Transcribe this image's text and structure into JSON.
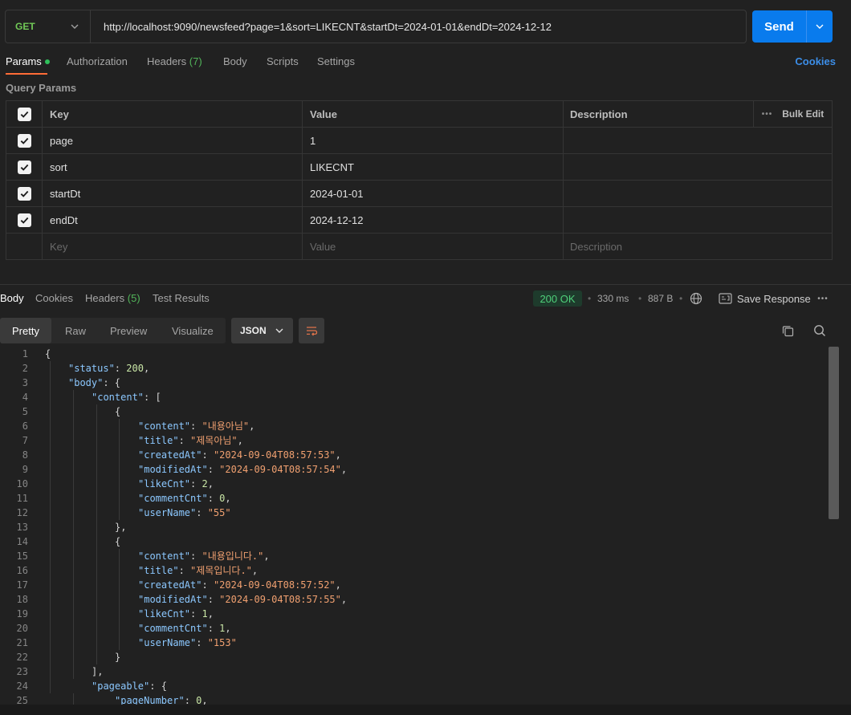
{
  "request": {
    "method": "GET",
    "url": "http://localhost:9090/newsfeed?page=1&sort=LIKECNT&startDt=2024-01-01&endDt=2024-12-12",
    "send_label": "Send"
  },
  "request_tabs": [
    {
      "label": "Params",
      "active": true
    },
    {
      "label": "Authorization"
    },
    {
      "label": "Headers",
      "count": "(7)"
    },
    {
      "label": "Body"
    },
    {
      "label": "Scripts"
    },
    {
      "label": "Settings"
    }
  ],
  "cookies_label": "Cookies",
  "query_params": {
    "title": "Query Params",
    "headers": {
      "key": "Key",
      "value": "Value",
      "description": "Description",
      "bulk_edit": "Bulk Edit"
    },
    "rows": [
      {
        "key": "page",
        "value": "1",
        "checked": true
      },
      {
        "key": "sort",
        "value": "LIKECNT",
        "checked": true
      },
      {
        "key": "startDt",
        "value": "2024-01-01",
        "checked": true
      },
      {
        "key": "endDt",
        "value": "2024-12-12",
        "checked": true
      }
    ],
    "placeholders": {
      "key": "Key",
      "value": "Value",
      "description": "Description"
    }
  },
  "response_tabs": [
    {
      "label": "Body",
      "active": true
    },
    {
      "label": "Cookies"
    },
    {
      "label": "Headers",
      "count": "(5)"
    },
    {
      "label": "Test Results"
    }
  ],
  "response_meta": {
    "status": "200 OK",
    "time": "330 ms",
    "size": "887 B",
    "save_label": "Save Response"
  },
  "view_tabs": [
    {
      "label": "Pretty",
      "active": true
    },
    {
      "label": "Raw"
    },
    {
      "label": "Preview"
    },
    {
      "label": "Visualize"
    }
  ],
  "format": "JSON",
  "colors": {
    "accent": "#ff6c37",
    "send": "#097bed",
    "method_get": "#71c957",
    "status_ok": "#4fd07a",
    "json_key": "#8cc8ff",
    "json_string": "#f0a070",
    "json_number": "#c9e6a6"
  },
  "icons": [
    "chevron-down-icon",
    "check-icon",
    "more-icon",
    "globe-icon",
    "save-icon",
    "wrap-icon",
    "copy-icon",
    "search-icon"
  ],
  "code_lines": [
    [
      {
        "t": "p",
        "v": "{"
      }
    ],
    [
      {
        "t": "k",
        "v": "\"status\""
      },
      {
        "t": "p",
        "v": ": "
      },
      {
        "t": "n",
        "v": "200"
      },
      {
        "t": "p",
        "v": ","
      }
    ],
    [
      {
        "t": "k",
        "v": "\"body\""
      },
      {
        "t": "p",
        "v": ": {"
      }
    ],
    [
      {
        "t": "k",
        "v": "\"content\""
      },
      {
        "t": "p",
        "v": ": ["
      }
    ],
    [
      {
        "t": "p",
        "v": "{"
      }
    ],
    [
      {
        "t": "k",
        "v": "\"content\""
      },
      {
        "t": "p",
        "v": ": "
      },
      {
        "t": "s",
        "v": "\"내용아님\""
      },
      {
        "t": "p",
        "v": ","
      }
    ],
    [
      {
        "t": "k",
        "v": "\"title\""
      },
      {
        "t": "p",
        "v": ": "
      },
      {
        "t": "s",
        "v": "\"제목아님\""
      },
      {
        "t": "p",
        "v": ","
      }
    ],
    [
      {
        "t": "k",
        "v": "\"createdAt\""
      },
      {
        "t": "p",
        "v": ": "
      },
      {
        "t": "s",
        "v": "\"2024-09-04T08:57:53\""
      },
      {
        "t": "p",
        "v": ","
      }
    ],
    [
      {
        "t": "k",
        "v": "\"modifiedAt\""
      },
      {
        "t": "p",
        "v": ": "
      },
      {
        "t": "s",
        "v": "\"2024-09-04T08:57:54\""
      },
      {
        "t": "p",
        "v": ","
      }
    ],
    [
      {
        "t": "k",
        "v": "\"likeCnt\""
      },
      {
        "t": "p",
        "v": ": "
      },
      {
        "t": "n",
        "v": "2"
      },
      {
        "t": "p",
        "v": ","
      }
    ],
    [
      {
        "t": "k",
        "v": "\"commentCnt\""
      },
      {
        "t": "p",
        "v": ": "
      },
      {
        "t": "n",
        "v": "0"
      },
      {
        "t": "p",
        "v": ","
      }
    ],
    [
      {
        "t": "k",
        "v": "\"userName\""
      },
      {
        "t": "p",
        "v": ": "
      },
      {
        "t": "s",
        "v": "\"55\""
      }
    ],
    [
      {
        "t": "p",
        "v": "},"
      }
    ],
    [
      {
        "t": "p",
        "v": "{"
      }
    ],
    [
      {
        "t": "k",
        "v": "\"content\""
      },
      {
        "t": "p",
        "v": ": "
      },
      {
        "t": "s",
        "v": "\"내용입니다.\""
      },
      {
        "t": "p",
        "v": ","
      }
    ],
    [
      {
        "t": "k",
        "v": "\"title\""
      },
      {
        "t": "p",
        "v": ": "
      },
      {
        "t": "s",
        "v": "\"제목입니다.\""
      },
      {
        "t": "p",
        "v": ","
      }
    ],
    [
      {
        "t": "k",
        "v": "\"createdAt\""
      },
      {
        "t": "p",
        "v": ": "
      },
      {
        "t": "s",
        "v": "\"2024-09-04T08:57:52\""
      },
      {
        "t": "p",
        "v": ","
      }
    ],
    [
      {
        "t": "k",
        "v": "\"modifiedAt\""
      },
      {
        "t": "p",
        "v": ": "
      },
      {
        "t": "s",
        "v": "\"2024-09-04T08:57:55\""
      },
      {
        "t": "p",
        "v": ","
      }
    ],
    [
      {
        "t": "k",
        "v": "\"likeCnt\""
      },
      {
        "t": "p",
        "v": ": "
      },
      {
        "t": "n",
        "v": "1"
      },
      {
        "t": "p",
        "v": ","
      }
    ],
    [
      {
        "t": "k",
        "v": "\"commentCnt\""
      },
      {
        "t": "p",
        "v": ": "
      },
      {
        "t": "n",
        "v": "1"
      },
      {
        "t": "p",
        "v": ","
      }
    ],
    [
      {
        "t": "k",
        "v": "\"userName\""
      },
      {
        "t": "p",
        "v": ": "
      },
      {
        "t": "s",
        "v": "\"153\""
      }
    ],
    [
      {
        "t": "p",
        "v": "}"
      }
    ],
    [
      {
        "t": "p",
        "v": "],"
      }
    ],
    [
      {
        "t": "k",
        "v": "\"pageable\""
      },
      {
        "t": "p",
        "v": ": {"
      }
    ],
    [
      {
        "t": "k",
        "v": "\"pageNumber\""
      },
      {
        "t": "p",
        "v": ": "
      },
      {
        "t": "n",
        "v": "0"
      },
      {
        "t": "p",
        "v": ","
      }
    ]
  ]
}
